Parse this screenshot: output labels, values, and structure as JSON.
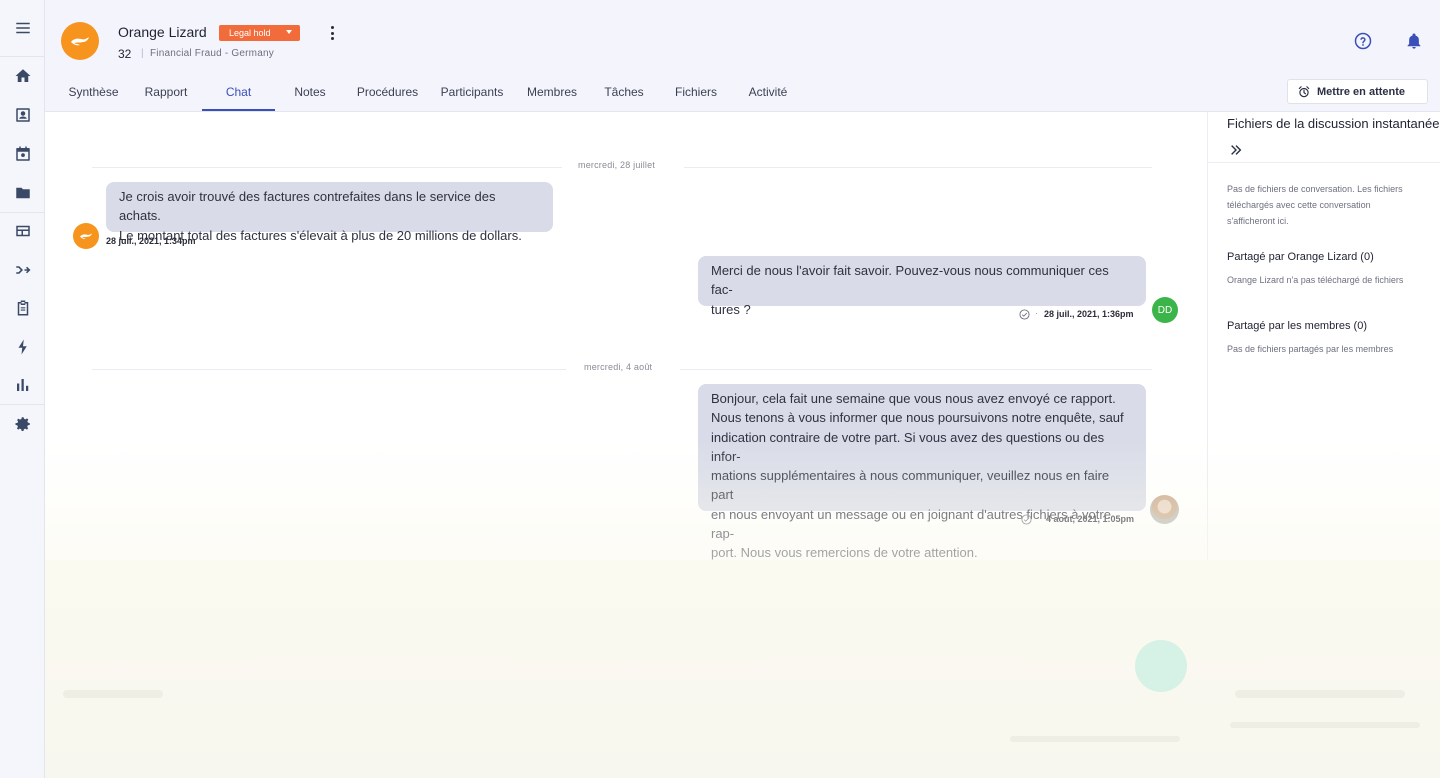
{
  "colors": {
    "accent": "#3a4fb8",
    "brand_orange": "#f7941d",
    "badge": "#f26b3a",
    "bubble": "#d9dce8",
    "avatar_green": "#3bb54a"
  },
  "rail": {
    "items": [
      {
        "icon": "menu-icon"
      },
      {
        "icon": "home-icon"
      },
      {
        "icon": "inbox-icon"
      },
      {
        "icon": "calendar-icon"
      },
      {
        "icon": "folder-icon"
      },
      {
        "icon": "table-icon"
      },
      {
        "icon": "merge-icon"
      },
      {
        "icon": "clipboard-icon"
      },
      {
        "icon": "lightning-icon"
      },
      {
        "icon": "bar-chart-icon"
      },
      {
        "icon": "settings-icon"
      }
    ]
  },
  "case": {
    "name": "Orange Lizard",
    "badge": "Legal hold",
    "number": "32",
    "separator": "|",
    "subtitle": "Financial Fraud - Germany"
  },
  "tabs": [
    {
      "label": "Synthèse"
    },
    {
      "label": "Rapport"
    },
    {
      "label": "Chat",
      "active": true
    },
    {
      "label": "Notes"
    },
    {
      "label": "Procédures"
    },
    {
      "label": "Participants"
    },
    {
      "label": "Membres"
    },
    {
      "label": "Tâches"
    },
    {
      "label": "Fichiers"
    },
    {
      "label": "Activité"
    }
  ],
  "actions": {
    "hold_label": "Mettre en attente"
  },
  "chat": {
    "days": [
      {
        "label": "mercredi, 28 juillet"
      },
      {
        "label": "mercredi, 4 août"
      }
    ],
    "messages": [
      {
        "text": "Je crois avoir trouvé des factures contrefaites dans le service des achats.\nLe montant total des factures s'élevait à plus de 20 millions de dollars.",
        "time": "28 juil., 2021, 1:34pm"
      },
      {
        "text": "Merci de nous l'avoir fait savoir. Pouvez-vous nous communiquer ces fac-\ntures ?",
        "time": "28 juil., 2021, 1:36pm",
        "avatar": "DD"
      },
      {
        "text": "Bonjour, cela fait une semaine que vous nous avez envoyé ce rapport.\nNous tenons à vous informer que nous poursuivons notre enquête, sauf\nindication contraire de votre part. Si vous avez des questions ou des infor-\nmations supplémentaires à nous communiquer, veuillez nous en faire part\nen nous envoyant un message ou en joignant d'autres fichiers à votre rap-\nport. Nous vous remercions de votre attention.",
        "time": "4 août, 2021, 1:05pm"
      }
    ],
    "dot": "·"
  },
  "panel": {
    "title": "Fichiers de la discussion instantanée",
    "intro": "Pas de fichiers de conversation. Les fichiers téléchargés avec cette conversation s'afficheront ici.",
    "shared_by_case": "Partagé par Orange Lizard (0)",
    "shared_by_case_text": "Orange Lizard n'a pas téléchargé de fichiers",
    "shared_by_members": "Partagé par les membres (0)",
    "shared_by_members_text": "Pas de fichiers partagés par les membres"
  }
}
